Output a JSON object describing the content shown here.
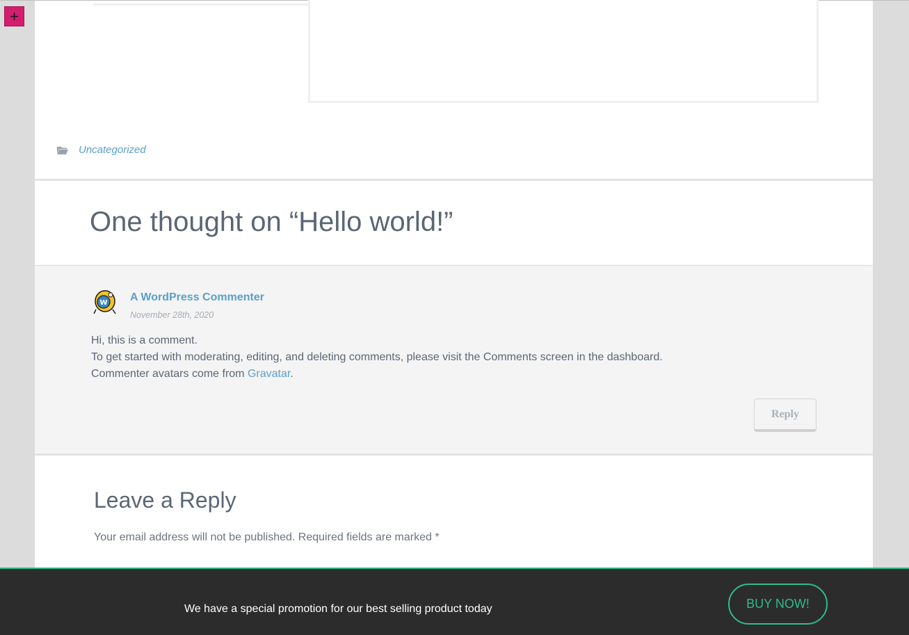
{
  "toolbar": {
    "add_label": "+"
  },
  "post": {
    "category": "Uncategorized"
  },
  "comments": {
    "title": "One thought on “Hello world!”",
    "items": [
      {
        "author": "A WordPress Commenter",
        "date": "November 28th, 2020",
        "line1": "Hi, this is a comment.",
        "line2": "To get started with moderating, editing, and deleting comments, please visit the Comments screen in the dashboard.",
        "line3_prefix": "Commenter avatars come from ",
        "line3_link": "Gravatar",
        "line3_suffix": ".",
        "reply_label": "Reply"
      }
    ]
  },
  "reply_form": {
    "title": "Leave a Reply",
    "notes": "Your email address will not be published. Required fields are marked *"
  },
  "promo": {
    "text": "We have a special promotion for our best selling product today",
    "button_label": "BUY NOW!"
  },
  "colors": {
    "accent": "#2fba8f",
    "link": "#5aa0c8",
    "add_button": "#d41d6e"
  }
}
